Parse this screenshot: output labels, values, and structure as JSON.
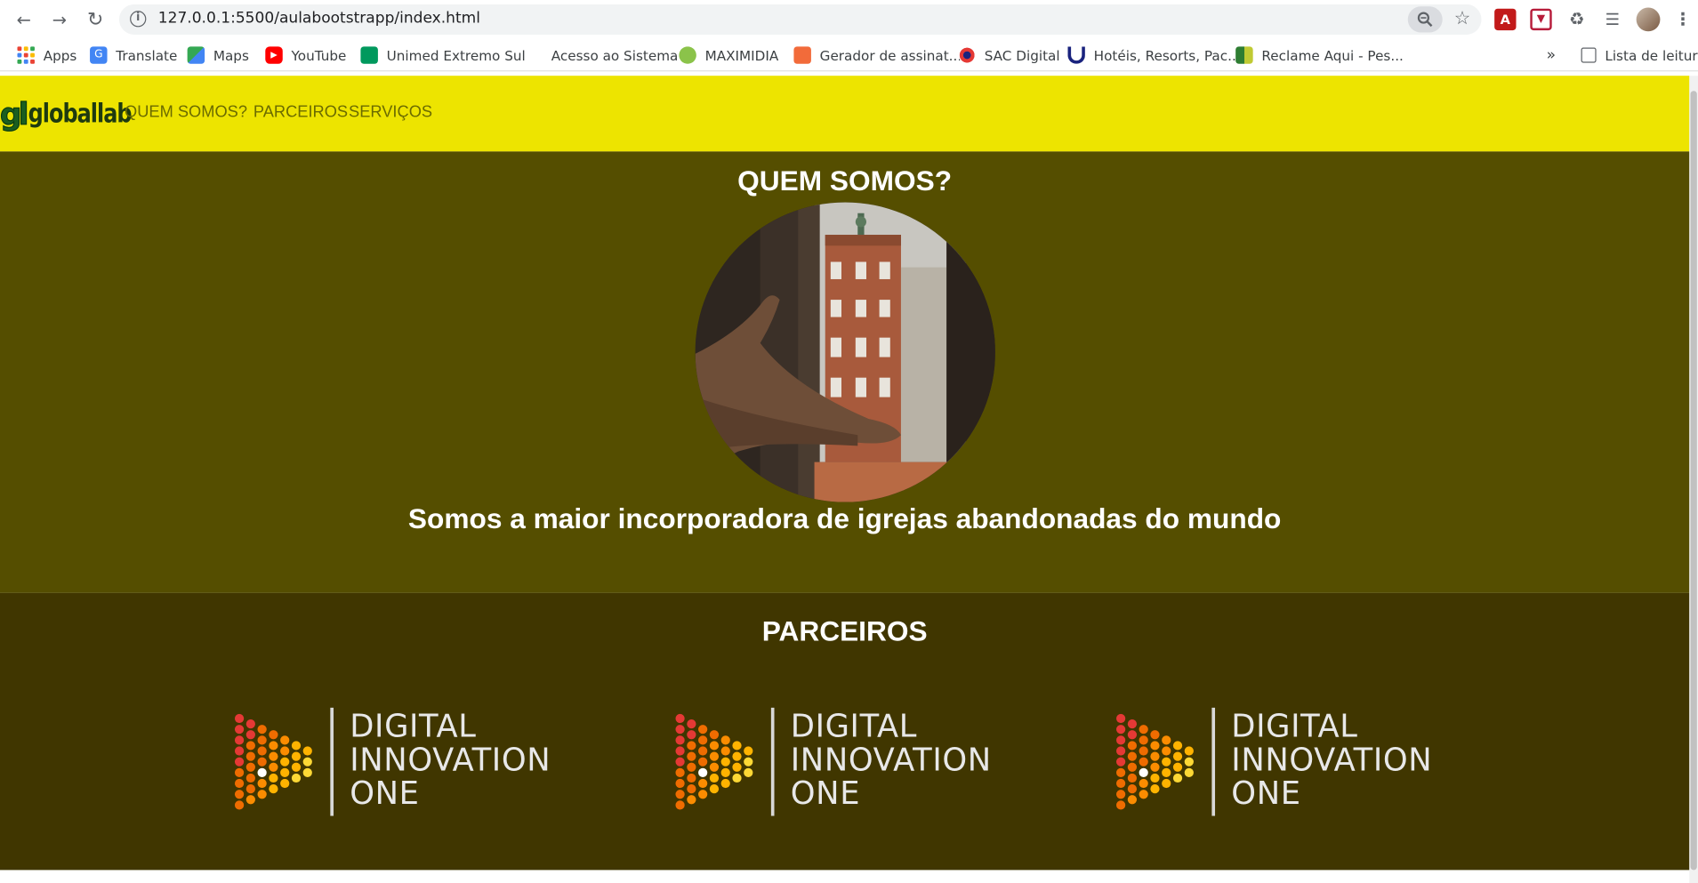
{
  "browser": {
    "url": "127.0.0.1:5500/aulabootstrapp/index.html",
    "bookmarks": [
      {
        "label": "Apps"
      },
      {
        "label": "Translate"
      },
      {
        "label": "Maps"
      },
      {
        "label": "YouTube"
      },
      {
        "label": "Unimed Extremo Sul"
      },
      {
        "label": "Acesso ao Sistema"
      },
      {
        "label": "MAXIMIDIA"
      },
      {
        "label": "Gerador de assinat..."
      },
      {
        "label": "SAC Digital"
      },
      {
        "label": "Hotéis, Resorts, Pac..."
      },
      {
        "label": "Reclame Aqui - Pes..."
      }
    ],
    "more": "»",
    "reading_list": "Lista de leitura"
  },
  "site": {
    "logo_mark": "gl",
    "logo_text": "globallab",
    "nav": [
      "QUEM SOMOS?",
      "PARCEIROS",
      "SERVIÇOS"
    ],
    "quem": {
      "title": "QUEM SOMOS?",
      "text": "Somos a maior incorporadora de igrejas abandonadas do mundo"
    },
    "parceiros": {
      "title": "PARCEIROS",
      "partners": [
        {
          "line1": "DIGITAL",
          "line2": "INNOVATION",
          "line3": "ONE"
        },
        {
          "line1": "DIGITAL",
          "line2": "INNOVATION",
          "line3": "ONE"
        },
        {
          "line1": "DIGITAL",
          "line2": "INNOVATION",
          "line3": "ONE"
        }
      ]
    }
  },
  "colors": {
    "navbar": "#ede400",
    "quem_bg": "#554e00",
    "parceiros_bg": "#403600"
  }
}
